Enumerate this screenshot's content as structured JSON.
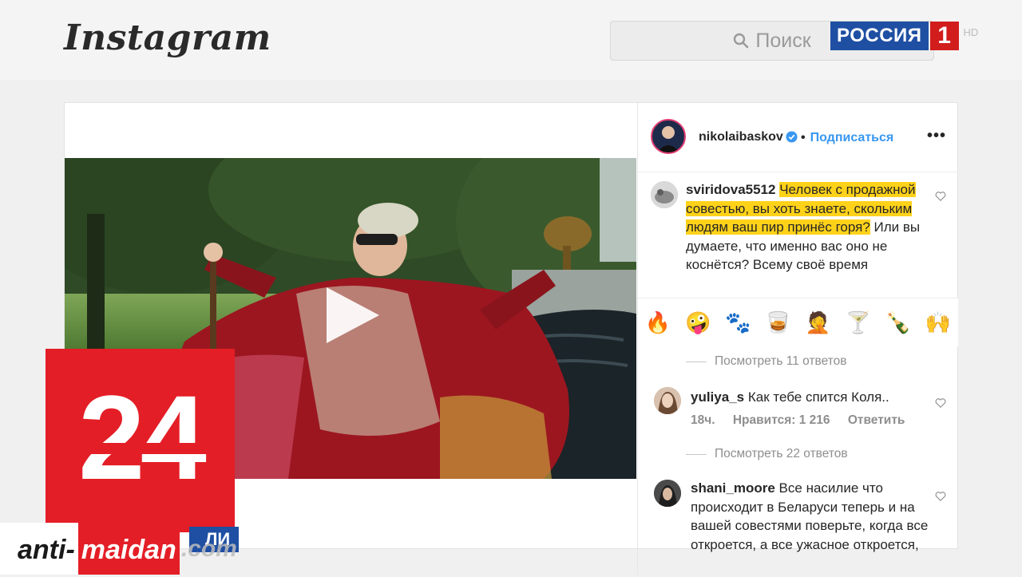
{
  "header": {
    "logo_text": "Instagram",
    "search_placeholder": "Поиск"
  },
  "channel": {
    "name": "РОССИЯ",
    "number": "1",
    "quality": "HD"
  },
  "post": {
    "username": "nikolaibaskov",
    "follow_label": "Подписаться",
    "dot": "•",
    "more": "•••"
  },
  "comments": [
    {
      "user": "sviridova5512",
      "text_highlighted": "Человек с продажной совестью, вы хоть знаете, скольким людям ваш пир принёс горя?",
      "text_plain": "Или вы думаете, что именно вас оно не коснётся? Всему своё время"
    },
    {
      "user": "yuliya_s",
      "text": "Как тебе спится Коля..",
      "time": "18ч.",
      "likes": "Нравится: 1 216",
      "reply_label": "Ответить"
    },
    {
      "user": "shani_moore",
      "text": "Все насилие что происходит в Беларуси теперь и на вашей совестями поверьте, когда все откроется, а все ужасное откроется,"
    }
  ],
  "view_replies": [
    "Посмотреть 11 ответов",
    "Посмотреть 22 ответов"
  ],
  "emoji_bar": [
    "🔥",
    "🤪",
    "🐾",
    "🥃",
    "🤦",
    "🍸",
    "🍾",
    "🙌"
  ],
  "overlay": {
    "badge_number": "24",
    "strip_text": "ЛИ",
    "watermark_part1": "anti-",
    "watermark_part2": "maidan",
    "watermark_part3": ".com"
  },
  "colors": {
    "highlight": "#ffd21a",
    "link_blue": "#3897f0",
    "badge_red": "#e41e26",
    "channel_blue": "#1f4fa3"
  }
}
